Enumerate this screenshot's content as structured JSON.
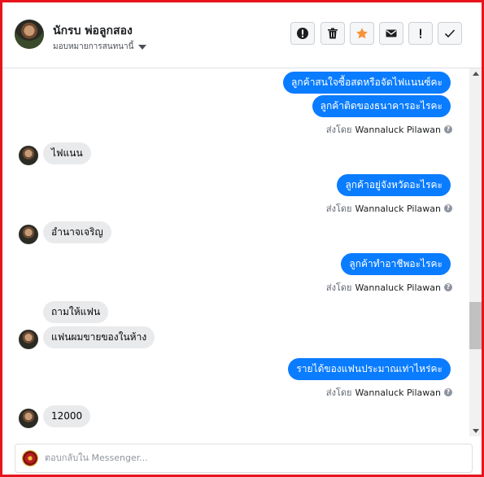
{
  "header": {
    "contact_name": "นักรบ พ่อลูกสอง",
    "assign_label": "มอบหมายการสนทนานี้",
    "toolbar": [
      {
        "icon": "alert-circle-icon",
        "name": "mark-spam-button"
      },
      {
        "icon": "trash-icon",
        "name": "delete-button"
      },
      {
        "icon": "star-icon",
        "name": "star-button",
        "color": "#f7923a"
      },
      {
        "icon": "envelope-icon",
        "name": "mark-unread-button"
      },
      {
        "icon": "exclamation-icon",
        "name": "follow-up-button"
      },
      {
        "icon": "check-icon",
        "name": "mark-done-button"
      }
    ]
  },
  "messages": [
    {
      "side": "out",
      "text": "ลูกค้าสนใจซื้อสดหรือจัดไฟแนนซ์คะ"
    },
    {
      "side": "out",
      "text": "ลูกค้าติดของธนาคารอะไรคะ"
    },
    {
      "sent_by_prefix": "ส่งโดย",
      "sent_by_name": "Wannaluck Pilawan"
    },
    {
      "side": "in",
      "text": "ไฟแนน"
    },
    {
      "side": "out",
      "text": "ลูกค้าอยู่จังหวัดอะไรคะ"
    },
    {
      "sent_by_prefix": "ส่งโดย",
      "sent_by_name": "Wannaluck Pilawan"
    },
    {
      "side": "in",
      "text": "อำนาจเจริญ"
    },
    {
      "side": "out",
      "text": "ลูกค้าทำอาชีพอะไรคะ"
    },
    {
      "sent_by_prefix": "ส่งโดย",
      "sent_by_name": "Wannaluck Pilawan"
    },
    {
      "side": "in",
      "text": "ถามให้แฟน"
    },
    {
      "side": "in",
      "text": "แฟนผมขายของในห้าง"
    },
    {
      "side": "out",
      "text": "รายได้ของแฟนประมาณเท่าไหร่คะ"
    },
    {
      "sent_by_prefix": "ส่งโดย",
      "sent_by_name": "Wannaluck Pilawan"
    },
    {
      "side": "in",
      "text": "12000"
    }
  ],
  "composer": {
    "placeholder": "ตอบกลับใน Messenger..."
  },
  "colors": {
    "outgoing_bubble": "#0a7cff",
    "incoming_bubble": "#e9eaeb",
    "frame_border": "#e8141b",
    "star": "#f7923a"
  }
}
